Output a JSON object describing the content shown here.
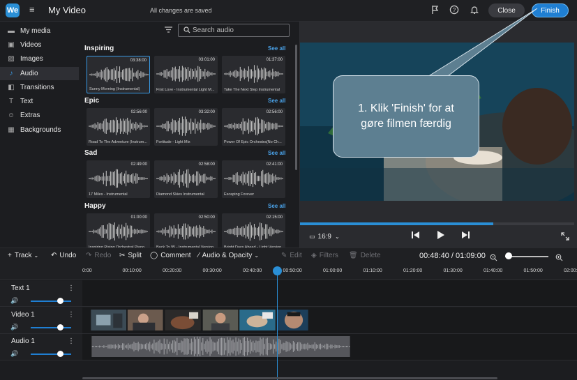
{
  "header": {
    "logo": "We",
    "title": "My Video",
    "status": "All changes are saved",
    "close_label": "Close",
    "finish_label": "Finish",
    "icons": [
      "menu-icon",
      "feedback-flag-icon",
      "help-icon",
      "bell-icon"
    ]
  },
  "sidebar": {
    "items": [
      {
        "label": "My media",
        "icon": "folder-icon"
      },
      {
        "label": "Videos",
        "icon": "film-icon"
      },
      {
        "label": "Images",
        "icon": "image-icon"
      },
      {
        "label": "Audio",
        "icon": "music-note-icon",
        "active": true
      },
      {
        "label": "Transitions",
        "icon": "transitions-icon"
      },
      {
        "label": "Text",
        "icon": "text-icon"
      },
      {
        "label": "Extras",
        "icon": "smiley-icon"
      },
      {
        "label": "Backgrounds",
        "icon": "backgrounds-icon"
      }
    ]
  },
  "library": {
    "search_placeholder": "Search audio",
    "see_all": "See all",
    "categories": [
      {
        "title": "Inspiring",
        "tracks": [
          {
            "duration": "03:38:00",
            "name": "Sunny Morning (Instrumental)",
            "selected": true
          },
          {
            "duration": "03:01:00",
            "name": "First Love - Instrumental Light M..."
          },
          {
            "duration": "01:37:00",
            "name": "Take The Next Step Instrumental"
          }
        ]
      },
      {
        "title": "Epic",
        "tracks": [
          {
            "duration": "02:56:00",
            "name": "Road To The Adventure (Instrum..."
          },
          {
            "duration": "03:32:00",
            "name": "Fortitude - Light Mix"
          },
          {
            "duration": "02:56:00",
            "name": "Power Of Epic Orchestra(No Ch..."
          }
        ]
      },
      {
        "title": "Sad",
        "tracks": [
          {
            "duration": "02:49:00",
            "name": "17 Miles - Instrumental"
          },
          {
            "duration": "02:58:00",
            "name": "Diamond Skies Instrumental"
          },
          {
            "duration": "02:41:00",
            "name": "Escaping Forever"
          }
        ]
      },
      {
        "title": "Happy",
        "tracks": [
          {
            "duration": "01:00:00",
            "name": "Inspiring Rising Orchestral Piano..."
          },
          {
            "duration": "02:50:00",
            "name": "Back To 95 - Instrumental Version"
          },
          {
            "duration": "02:15:00",
            "name": "Bright Days Ahead - Light Version"
          }
        ]
      }
    ]
  },
  "preview": {
    "aspect_ratio": "16:9",
    "progress": 0.705,
    "callout": "1. Klik 'Finish' for at gøre filmen færdig"
  },
  "toolbar": {
    "track": "Track",
    "undo": "Undo",
    "redo": "Redo",
    "split": "Split",
    "comment": "Comment",
    "audio_opacity": "Audio & Opacity",
    "edit": "Edit",
    "filters": "Filters",
    "delete": "Delete",
    "timecode": "00:48:40 / 01:09:00",
    "zoom": 0.05
  },
  "ruler": [
    "0:00",
    "00:10:00",
    "00:20:00",
    "00:30:00",
    "00:40:00",
    "00:50:00",
    "01:00:00",
    "01:10:00",
    "01:20:00",
    "01:30:00",
    "01:40:00",
    "01:50:00",
    "02:00:00"
  ],
  "tracks": [
    {
      "name": "Text 1",
      "volume": 0.73
    },
    {
      "name": "Video 1",
      "volume": 0.73
    },
    {
      "name": "Audio 1",
      "volume": 0.73
    }
  ],
  "colors": {
    "accent": "#2a8fd6",
    "background": "#1c1d20",
    "callout": "#5d7f91"
  }
}
